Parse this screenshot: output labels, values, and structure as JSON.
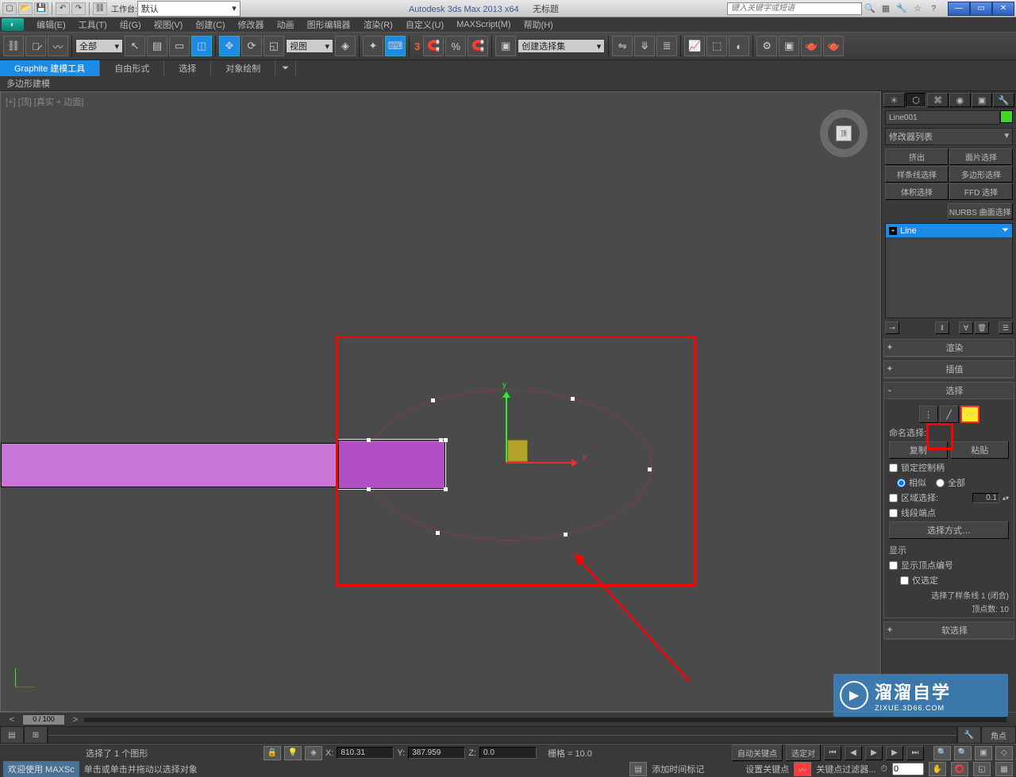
{
  "titlebar": {
    "workspace_label": "工作台:",
    "workspace_value": "默认",
    "app_title": "Autodesk 3ds Max  2013 x64",
    "doc_title": "无标题",
    "search_placeholder": "键入关键字或短语"
  },
  "menu": {
    "edit": "编辑(E)",
    "tools": "工具(T)",
    "group": "组(G)",
    "views": "视图(V)",
    "create": "创建(C)",
    "modifiers": "修改器",
    "animation": "动画",
    "graph": "图形编辑器",
    "rendering": "渲染(R)",
    "customize": "自定义(U)",
    "maxscript": "MAXScript(M)",
    "help": "帮助(H)"
  },
  "ribbon": {
    "tab1": "Graphite 建模工具",
    "tab2": "自由形式",
    "tab3": "选择",
    "tab4": "对象绘制",
    "sub": "多边形建模"
  },
  "toolbar": {
    "filter": "全部",
    "view": "视图",
    "selset": "创建选择集"
  },
  "viewport": {
    "label": "[+] [顶] [真实 + 边面]",
    "gizmo_x": "x",
    "gizmo_y": "y"
  },
  "cmd": {
    "obj_name": "Line001",
    "mod_list": "修改器列表",
    "btn_extrude": "挤出",
    "btn_face": "面片选择",
    "btn_spline": "样条线选择",
    "btn_poly": "多边形选择",
    "btn_vol": "体积选择",
    "btn_ffd": "FFD 选择",
    "btn_nurbs": "NURBS 曲面选择",
    "stack_line": "Line",
    "rollout_render": "渲染",
    "rollout_interp": "插值",
    "rollout_select": "选择",
    "named_sel_label": "命名选择:",
    "btn_copy": "复制",
    "btn_paste": "粘贴",
    "chk_lock": "锁定控制柄",
    "radio_similar": "相似",
    "radio_all": "全部",
    "chk_area": "区域选择:",
    "area_val": "0.1",
    "chk_seg": "线段端点",
    "btn_method": "选择方式…",
    "display_label": "显示",
    "chk_vertnum": "显示顶点编号",
    "chk_selonly": "仅选定",
    "status1": "选择了样条线 1 (闭合)",
    "status2": "顶点数: 10",
    "rollout_soft": "软选择"
  },
  "watermark": {
    "text1": "溜溜自学",
    "text2": "ZIXUE.3D66.COM"
  },
  "timeslider": {
    "pos": "0 / 100"
  },
  "status": {
    "sel": "选择了 1 个图形",
    "x_label": "X:",
    "x": "810.31",
    "y_label": "Y:",
    "y": "387.959",
    "z_label": "Z:",
    "z": "0.0",
    "grid": "栅格 = 10.0",
    "autokey": "自动关键点",
    "selset2": "选定对",
    "corner": "角点"
  },
  "status2": {
    "panel": "欢迎使用  MAXSc",
    "hint": "单击或单击并拖动以选择对象",
    "addtime": "添加时间标记",
    "setkey": "设置关键点",
    "keyfilter": "关键点过滤器..."
  }
}
